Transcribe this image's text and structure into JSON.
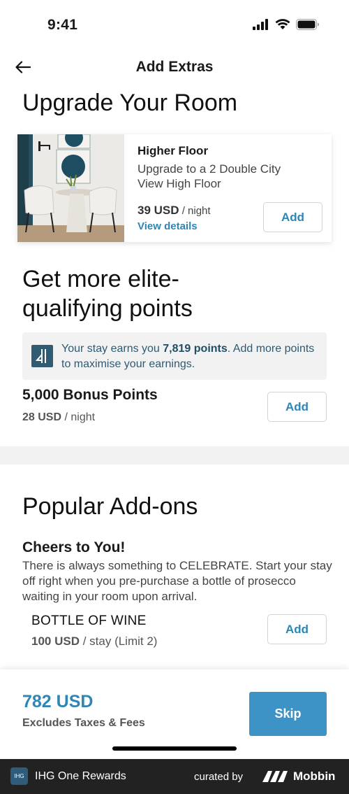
{
  "status_bar": {
    "time": "9:41"
  },
  "nav": {
    "title": "Add Extras"
  },
  "upgrade": {
    "heading": "Upgrade Your Room",
    "room": {
      "title": "Higher Floor",
      "description": "Upgrade to a 2 Double City View High Floor",
      "price_amount": "39 USD",
      "price_unit": "/ night",
      "view_details_label": "View details",
      "add_label": "Add"
    }
  },
  "points": {
    "heading": "Get more elite-qualifying points",
    "info_prefix": "Your stay earns you ",
    "info_points": "7,819 points",
    "info_suffix": ". Add more points to maximise your earnings.",
    "bonus_title": "5,000 Bonus Points",
    "bonus_price_amount": "28 USD",
    "bonus_price_unit": "/ night",
    "add_label": "Add"
  },
  "addons": {
    "heading": "Popular Add-ons",
    "item_title": "Cheers to You!",
    "item_description": "There is always something to CELEBRATE. Start your stay off right when you pre-purchase a bottle of prosecco waiting in your room upon arrival.",
    "product_title": "BOTTLE OF WINE",
    "product_price_amount": "100 USD",
    "product_price_unit": "/ stay (Limit 2)",
    "add_label": "Add"
  },
  "bottom": {
    "total": "782 USD",
    "total_note": "Excludes Taxes & Fees",
    "skip_label": "Skip"
  },
  "footer": {
    "logo_text": "IHG",
    "app_name": "IHG One Rewards",
    "curated_by": "curated by",
    "brand": "Mobbin"
  },
  "colors": {
    "accent": "#2e86b5",
    "primary_button": "#3d93c6",
    "info_bg": "#f2f2f3",
    "footer_bg": "#222222"
  }
}
